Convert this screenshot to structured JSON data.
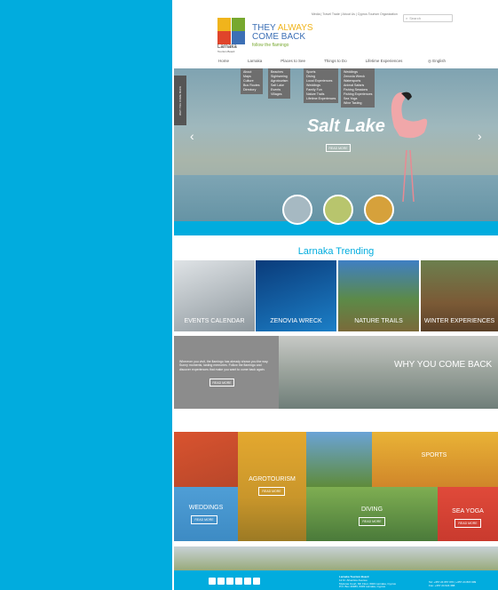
{
  "header": {
    "top_links": "Media | Travel Trade | About Us | Cyprus Tourism Organization",
    "search_placeholder": "Search",
    "logo_wordmark": "Larnaka",
    "logo_sub": "Tourism Board",
    "tagline_they": "THEY",
    "tagline_always": "ALWAYS",
    "tagline_come_back": "COME BACK",
    "tagline_sub": "follow the flamingo"
  },
  "nav": {
    "items": [
      "Home",
      "Larnaka",
      "Places to See",
      "Things to Do",
      "Lifetime Experiences"
    ],
    "language": "English"
  },
  "dropdowns": {
    "larnaka": [
      "About",
      "Maps",
      "Culture",
      "Bus Routes",
      "Directory"
    ],
    "places": [
      "Beaches",
      "Sightseeing",
      "Agrotourism",
      "Salt Lake",
      "Events",
      "Villages"
    ],
    "things": [
      "Sports",
      "Diving",
      "Local Experiences",
      "Weddings",
      "Family Fun",
      "Nature Trails",
      "Lifetime Experiences"
    ],
    "lifetime": [
      "Weddings",
      "Zenovia Wreck",
      "Watersports",
      "Animal Safaris",
      "Fishing Sessions",
      "Fishing Experiences",
      "Sea Yoga",
      "Wine Tasting"
    ]
  },
  "hero": {
    "side_tab": "WHY YOU COME BACK",
    "title": "Salt Lake",
    "button": "READ MORE"
  },
  "trending": {
    "title": "Larnaka Trending",
    "tiles": [
      "EVENTS CALENDAR",
      "ZENOVIA WRECK",
      "NATURE TRAILS",
      "WINTER EXPERIENCES"
    ]
  },
  "why": {
    "text": "Wherever you visit, the flamingo has already shown you the way. Sunny moments, lasting memories. Follow the flamingo and discover experiences that make you want to come back again.",
    "button": "READ MORE",
    "title": "WHY YOU COME BACK"
  },
  "mosaic": {
    "agrotourism": "AGROTOURISM",
    "agrotourism_btn": "READ MORE",
    "sports": "SPORTS",
    "weddings": "WEDDINGS",
    "weddings_btn": "READ MORE",
    "diving": "DIVING",
    "diving_btn": "READ MORE",
    "sea_yoga": "SEA YOGA",
    "sea_yoga_btn": "READ MORE"
  },
  "footer": {
    "org": "Larnaka Tourism Board",
    "line1": "12 Kr. Afxentiou Avenue",
    "line2": "Mylonas Court, 6th Floor, 6023 Larnaka, Cyprus",
    "line3": "P.O. Box 40383, 6303 Larnaka, Cyprus",
    "tel": "Tel: +357 24 657 070 | +357 24 815 999",
    "fax": "Fax: +357 24 624 388"
  },
  "colors": {
    "brand_blue": "#01acde"
  }
}
